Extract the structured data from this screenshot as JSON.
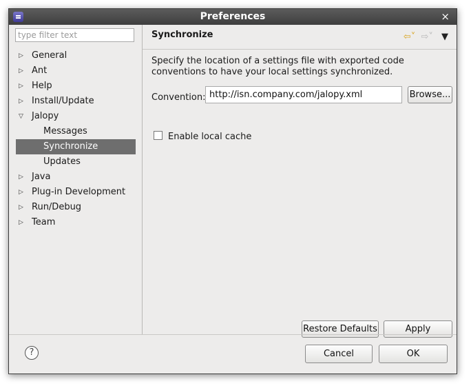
{
  "window": {
    "title": "Preferences",
    "close_glyph": "×"
  },
  "filter": {
    "placeholder": "type filter text",
    "value": ""
  },
  "tree": {
    "items": [
      {
        "label": "General",
        "state": "collapsed"
      },
      {
        "label": "Ant",
        "state": "collapsed"
      },
      {
        "label": "Help",
        "state": "collapsed"
      },
      {
        "label": "Install/Update",
        "state": "collapsed"
      },
      {
        "label": "Jalopy",
        "state": "expanded"
      },
      {
        "label": "Messages",
        "state": "child"
      },
      {
        "label": "Synchronize",
        "state": "child-selected"
      },
      {
        "label": "Updates",
        "state": "child"
      },
      {
        "label": "Java",
        "state": "collapsed"
      },
      {
        "label": "Plug-in Development",
        "state": "collapsed"
      },
      {
        "label": "Run/Debug",
        "state": "collapsed"
      },
      {
        "label": "Team",
        "state": "collapsed"
      }
    ]
  },
  "page": {
    "title": "Synchronize",
    "description": "Specify the location of a settings file with exported code conventions to have your local settings synchronized.",
    "convention_label": "Convention:",
    "convention_value": "http://isn.company.com/jalopy.xml",
    "browse_label": "Browse...",
    "enable_cache_label": "Enable local cache",
    "enable_cache_checked": false,
    "restore_defaults_label": "Restore Defaults",
    "apply_label": "Apply"
  },
  "footer": {
    "help_glyph": "?",
    "cancel_label": "Cancel",
    "ok_label": "OK"
  },
  "icons": {
    "app": "eclipse-icon",
    "back": "back-arrow-icon",
    "forward": "forward-arrow-icon",
    "menu": "view-menu-icon",
    "tree_collapsed": "triangle-right-icon",
    "tree_expanded": "triangle-down-icon",
    "help": "help-icon"
  },
  "colors": {
    "selection": "#6e6e6e",
    "titlebar": "#4a4a4a",
    "back_arrow": "#d9a520"
  }
}
